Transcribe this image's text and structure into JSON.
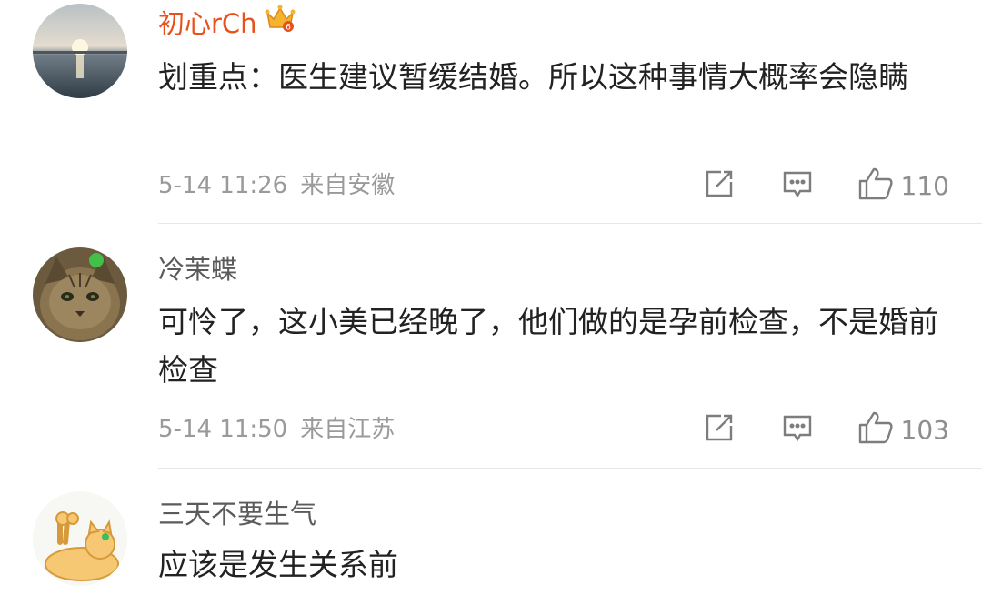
{
  "comments": [
    {
      "username": "初心rCh",
      "text": "划重点：医生建议暂缓结婚。所以这种事情大概率会隐瞒",
      "date": "5-14 11:26",
      "location": "来自安徽",
      "likes": "110",
      "badge_level": "6"
    },
    {
      "username": "冷茉蝶",
      "text": "可怜了，这小美已经晚了，他们做的是孕前检查，不是婚前检查",
      "date": "5-14 11:50",
      "location": "来自江苏",
      "likes": "103"
    },
    {
      "username": "三天不要生气",
      "text": "应该是发生关系前"
    }
  ],
  "colors": {
    "vip_name": "#e8511c",
    "name": "#5b5b5b",
    "meta": "#9a9a9a",
    "text": "#222222"
  }
}
